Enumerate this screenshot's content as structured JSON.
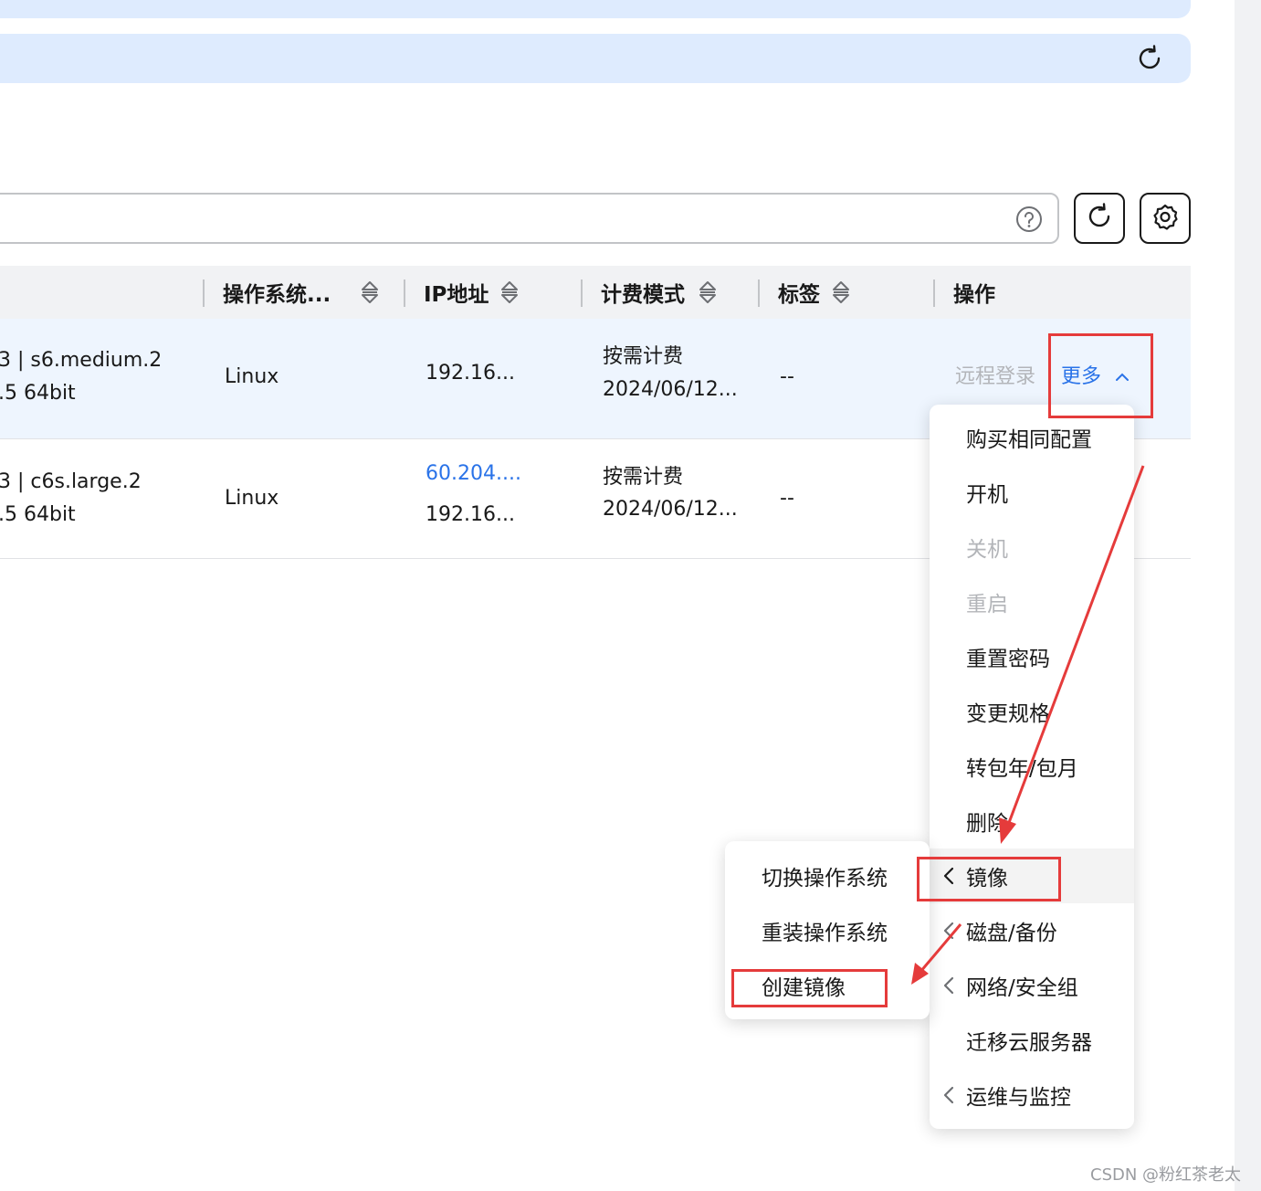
{
  "header": {
    "refresh_icon": "refresh-icon"
  },
  "search": {
    "placeholder": "",
    "help_icon": "question-circle-icon"
  },
  "toolbar": {
    "refresh_icon": "refresh-icon",
    "settings_icon": "gear-icon"
  },
  "table": {
    "columns": [
      "操作系统...",
      "IP地址",
      "计费模式",
      "标签",
      "操作"
    ],
    "rows": [
      {
        "spec": "3 | s6.medium.2",
        "image": ".5 64bit",
        "os": "Linux",
        "ip_lines": [
          "192.16..."
        ],
        "billing": "按需计费",
        "created": "2024/06/12...",
        "tags": "--",
        "action_remote": "远程登录",
        "action_more": "更多"
      },
      {
        "spec": "3 | c6s.large.2",
        "image": ".5 64bit",
        "os": "Linux",
        "ip_lines": [
          "60.204....",
          "192.16..."
        ],
        "billing": "按需计费",
        "created": "2024/06/12...",
        "tags": "--"
      }
    ]
  },
  "more_menu": {
    "items": [
      {
        "label": "购买相同配置",
        "disabled": false,
        "submenu": false
      },
      {
        "label": "开机",
        "disabled": false,
        "submenu": false
      },
      {
        "label": "关机",
        "disabled": true,
        "submenu": false
      },
      {
        "label": "重启",
        "disabled": true,
        "submenu": false
      },
      {
        "label": "重置密码",
        "disabled": false,
        "submenu": false
      },
      {
        "label": "变更规格",
        "disabled": false,
        "submenu": false
      },
      {
        "label": "转包年/包月",
        "disabled": false,
        "submenu": false
      },
      {
        "label": "删除",
        "disabled": false,
        "submenu": false
      },
      {
        "label": "镜像",
        "disabled": false,
        "submenu": true,
        "active": true
      },
      {
        "label": "磁盘/备份",
        "disabled": false,
        "submenu": true
      },
      {
        "label": "网络/安全组",
        "disabled": false,
        "submenu": true
      },
      {
        "label": "迁移云服务器",
        "disabled": false,
        "submenu": false
      },
      {
        "label": "运维与监控",
        "disabled": false,
        "submenu": true
      }
    ]
  },
  "image_submenu": {
    "items": [
      "切换操作系统",
      "重装操作系统",
      "创建镜像"
    ]
  },
  "annotation_color": "#e53b3b",
  "watermark": "CSDN @粉红茶老太"
}
